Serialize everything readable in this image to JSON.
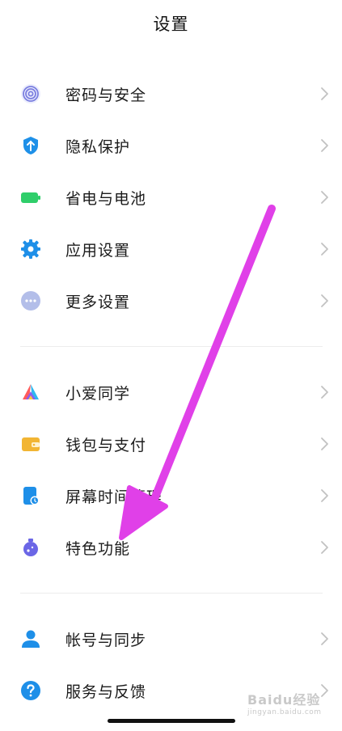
{
  "header": {
    "title": "设置"
  },
  "groups": [
    {
      "items": [
        {
          "label": "密码与安全",
          "icon": "fingerprint-icon",
          "color": "#7b7fe0"
        },
        {
          "label": "隐私保护",
          "icon": "privacy-shield-icon",
          "color": "#1e90e8"
        },
        {
          "label": "省电与电池",
          "icon": "battery-icon",
          "color": "#2fce6a"
        },
        {
          "label": "应用设置",
          "icon": "gear-icon",
          "color": "#1e8fe8"
        },
        {
          "label": "更多设置",
          "icon": "more-dots-icon",
          "color": "#a7b4e6"
        }
      ]
    },
    {
      "items": [
        {
          "label": "小爱同学",
          "icon": "xiaoai-icon",
          "color": "#ff5b5b"
        },
        {
          "label": "钱包与支付",
          "icon": "wallet-icon",
          "color": "#f2b533"
        },
        {
          "label": "屏幕时间管理",
          "icon": "screen-time-icon",
          "color": "#1e8fe8"
        },
        {
          "label": "特色功能",
          "icon": "potion-icon",
          "color": "#6b66e6"
        }
      ]
    },
    {
      "items": [
        {
          "label": "帐号与同步",
          "icon": "account-icon",
          "color": "#1e8fe8"
        },
        {
          "label": "服务与反馈",
          "icon": "help-icon",
          "color": "#1e8fe8"
        }
      ]
    }
  ],
  "overlay": {
    "annotation_arrow_color": "#e040e8"
  },
  "watermark": {
    "text": "Baidu经验",
    "subtext": "jingyan.baidu.com"
  }
}
